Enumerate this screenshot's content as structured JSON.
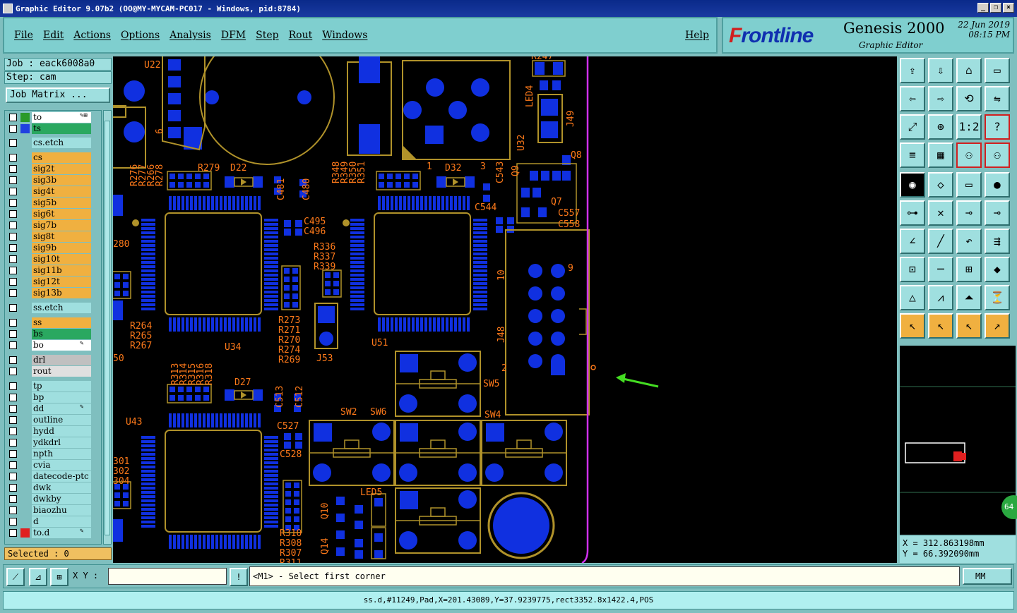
{
  "window": {
    "title": "Graphic Editor 9.07b2 (OO@MY-MYCAM-PC017 - Windows, pid:8784)",
    "btn_min": "_",
    "btn_restore": "❐",
    "btn_close": "×"
  },
  "menu": {
    "file": "File",
    "edit": "Edit",
    "actions": "Actions",
    "options": "Options",
    "analysis": "Analysis",
    "dfm": "DFM",
    "step": "Step",
    "rout": "Rout",
    "windows": "Windows",
    "help": "Help"
  },
  "logo": {
    "brand_prefix": "F",
    "brand_rest": "rontline",
    "product": "Genesis 2000",
    "subtitle": "Graphic Editor",
    "date": "22 Jun 2019",
    "time": "08:15 PM"
  },
  "left": {
    "job": "Job : eack6008a0",
    "step": "Step: cam",
    "job_matrix": "Job Matrix ...",
    "selected": "Selected : 0"
  },
  "layers": [
    {
      "name": "to",
      "bg": "#ffffff",
      "color": "#2a9a2a",
      "mark": "✎⊞"
    },
    {
      "name": "ts",
      "bg": "#2aa860",
      "color": "#2040e0",
      "mark": ""
    },
    {
      "name": "cs.etch",
      "bg": "#9fdfdf",
      "color": "",
      "mark": ""
    },
    {
      "name": "cs",
      "bg": "#f0b040",
      "color": "",
      "mark": ""
    },
    {
      "name": "sig2t",
      "bg": "#f0b040",
      "color": "",
      "mark": ""
    },
    {
      "name": "sig3b",
      "bg": "#f0b040",
      "color": "",
      "mark": ""
    },
    {
      "name": "sig4t",
      "bg": "#f0b040",
      "color": "",
      "mark": ""
    },
    {
      "name": "sig5b",
      "bg": "#f0b040",
      "color": "",
      "mark": ""
    },
    {
      "name": "sig6t",
      "bg": "#f0b040",
      "color": "",
      "mark": ""
    },
    {
      "name": "sig7b",
      "bg": "#f0b040",
      "color": "",
      "mark": ""
    },
    {
      "name": "sig8t",
      "bg": "#f0b040",
      "color": "",
      "mark": ""
    },
    {
      "name": "sig9b",
      "bg": "#f0b040",
      "color": "",
      "mark": ""
    },
    {
      "name": "sig10t",
      "bg": "#f0b040",
      "color": "",
      "mark": ""
    },
    {
      "name": "sig11b",
      "bg": "#f0b040",
      "color": "",
      "mark": ""
    },
    {
      "name": "sig12t",
      "bg": "#f0b040",
      "color": "",
      "mark": ""
    },
    {
      "name": "sig13b",
      "bg": "#f0b040",
      "color": "",
      "mark": ""
    },
    {
      "name": "ss.etch",
      "bg": "#9fdfdf",
      "color": "",
      "mark": ""
    },
    {
      "name": "ss",
      "bg": "#f0b040",
      "color": "",
      "mark": ""
    },
    {
      "name": "bs",
      "bg": "#2aa860",
      "color": "",
      "mark": ""
    },
    {
      "name": "bo",
      "bg": "#ffffff",
      "color": "",
      "mark": "✎"
    },
    {
      "name": "drl",
      "bg": "#c0c0c0",
      "color": "",
      "mark": ""
    },
    {
      "name": "rout",
      "bg": "#e0e0e0",
      "color": "",
      "mark": ""
    },
    {
      "name": "tp",
      "bg": "#9fdfdf",
      "color": "",
      "mark": ""
    },
    {
      "name": "bp",
      "bg": "#9fdfdf",
      "color": "",
      "mark": ""
    },
    {
      "name": "dd",
      "bg": "#9fdfdf",
      "color": "",
      "mark": "✎"
    },
    {
      "name": "outline",
      "bg": "#9fdfdf",
      "color": "",
      "mark": ""
    },
    {
      "name": "hydd",
      "bg": "#9fdfdf",
      "color": "",
      "mark": ""
    },
    {
      "name": "ydkdrl",
      "bg": "#9fdfdf",
      "color": "",
      "mark": ""
    },
    {
      "name": "npth",
      "bg": "#9fdfdf",
      "color": "",
      "mark": ""
    },
    {
      "name": "cvia",
      "bg": "#9fdfdf",
      "color": "",
      "mark": ""
    },
    {
      "name": "datecode-ptc",
      "bg": "#9fdfdf",
      "color": "",
      "mark": ""
    },
    {
      "name": "dwk",
      "bg": "#9fdfdf",
      "color": "",
      "mark": ""
    },
    {
      "name": "dwkby",
      "bg": "#9fdfdf",
      "color": "",
      "mark": ""
    },
    {
      "name": "biaozhu",
      "bg": "#9fdfdf",
      "color": "",
      "mark": ""
    },
    {
      "name": "d",
      "bg": "#9fdfdf",
      "color": "",
      "mark": ""
    },
    {
      "name": "to.d",
      "bg": "#9fdfdf",
      "color": "#e02020",
      "mark": "✎"
    }
  ],
  "pcb_labels": [
    "U22",
    "R279",
    "D22",
    "C481",
    "C480",
    "C495",
    "C496",
    "R348",
    "R349",
    "R350",
    "R351",
    "D32",
    "C543",
    "C544",
    "C557",
    "C558",
    "Q7",
    "Q8",
    "Q9",
    "J49",
    "LED4",
    "U32",
    "R247",
    "R336",
    "R337",
    "R339",
    "R264",
    "R265",
    "R267",
    "U34",
    "U51",
    "J53",
    "R273",
    "R271",
    "R270",
    "R274",
    "R269",
    "J48",
    "SW5",
    "SW2",
    "SW6",
    "SW4",
    "R313",
    "R314",
    "R315",
    "R316",
    "R318",
    "D27",
    "C513",
    "C512",
    "C527",
    "C528",
    "U43",
    "LED5",
    "Q10",
    "Q14",
    "R310",
    "R308",
    "R307",
    "R311",
    "R276",
    "R277",
    "R266",
    "R278",
    "280",
    "301",
    "302",
    "304",
    "50",
    "9",
    "10",
    "2",
    "1",
    "3",
    "6"
  ],
  "right": {
    "coord_x": "X = 312.863198mm",
    "coord_y": "Y = 66.392090mm",
    "zoom_badge": "64"
  },
  "bottom": {
    "xy_label": "X Y :",
    "xy_value": "",
    "prompt": "<M1> - Select first corner",
    "units": "MM",
    "status": "ss.d,#11249,Pad,X=201.43089,Y=37.9239775,rect3352.8x1422.4,POS"
  },
  "colors": {
    "canvas_bg": "#000000",
    "pad_blue": "#1030e0",
    "silk_orange": "#ff7a1a",
    "outline_gold": "#b0922a",
    "profile_magenta": "#d030f0",
    "arrow_green": "#44dd22"
  }
}
